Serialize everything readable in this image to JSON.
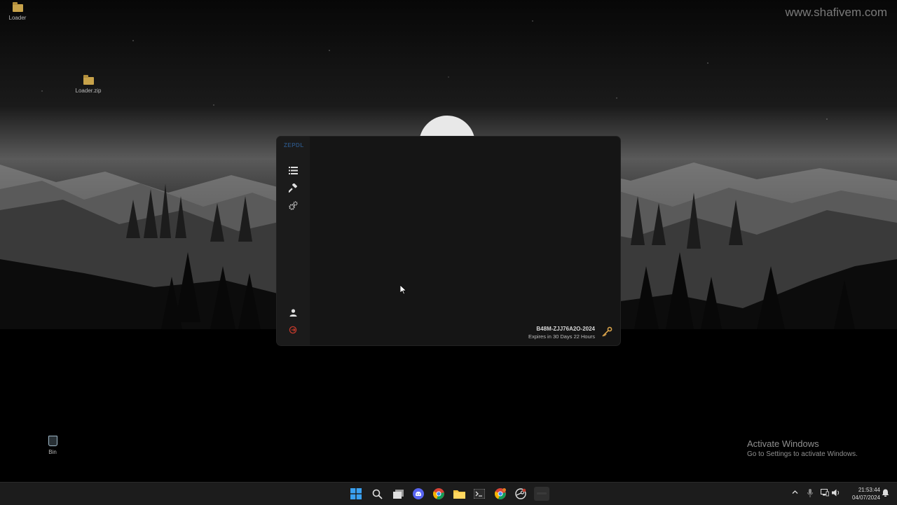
{
  "watermark": "www.shafivem.com",
  "desktop": {
    "icons": [
      {
        "label": "Loader",
        "type": "folder"
      },
      {
        "label": "Loader.zip",
        "type": "folder"
      },
      {
        "label": "Bin",
        "type": "recycle-bin"
      }
    ]
  },
  "activation": {
    "title": "Activate Windows",
    "subtitle": "Go to Settings to activate Windows."
  },
  "app": {
    "logo": "ZEPDL",
    "nav": [
      {
        "id": "list",
        "icon": "list-icon"
      },
      {
        "id": "tools",
        "icon": "hammer-icon"
      },
      {
        "id": "settings",
        "icon": "gears-icon"
      }
    ],
    "bottom_nav": [
      {
        "id": "profile",
        "icon": "user-icon"
      },
      {
        "id": "logout",
        "icon": "logout-icon"
      }
    ],
    "license": {
      "key": "B48M-ZJJ76A2O-2024",
      "expires": "Expires in 30 Days 22 Hours",
      "icon": "key-icon"
    },
    "colors": {
      "background": "#151515",
      "sidebar": "#1b1b1b",
      "logout_accent": "#c0392b",
      "key_accent": "#d8a24a",
      "logo": "#2a4f7a"
    }
  },
  "taskbar": {
    "apps": [
      "windows-start",
      "search",
      "task-view",
      "discord",
      "chrome",
      "file-explorer",
      "terminal",
      "chrome-alt",
      "steam",
      "app-window"
    ],
    "time": "21:53:44",
    "date": "04/07/2024"
  }
}
